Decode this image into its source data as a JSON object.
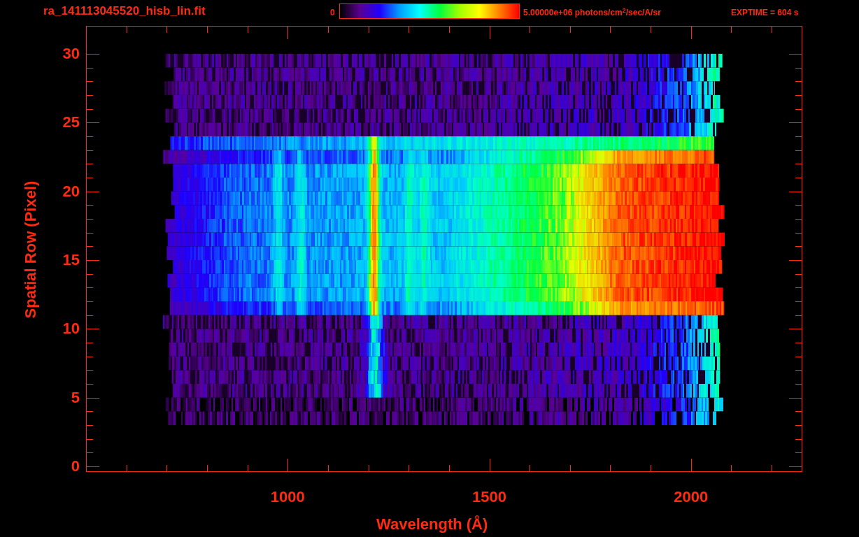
{
  "title": "ra_141113045520_hisb_lin.fit",
  "colorbar": {
    "min_label": "0",
    "max_label": "5.00000e+06 photons/cm$^{2}$/sec/A/sr"
  },
  "exptime": "EXPTIME = 604 s",
  "y_axis": {
    "label": "Spatial Row (Pixel)",
    "ticks": [
      "30",
      "25",
      "20",
      "15",
      "10",
      "5",
      "0"
    ]
  },
  "x_axis": {
    "label": "Wavelength (Å)",
    "ticks": [
      "1000",
      "1500",
      "2000"
    ]
  }
}
